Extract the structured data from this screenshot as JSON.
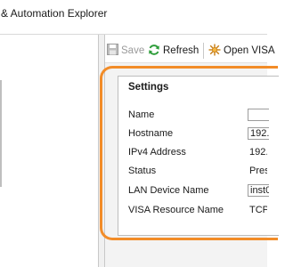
{
  "window": {
    "title": "& Automation Explorer"
  },
  "toolbar": {
    "save_label": "Save",
    "refresh_label": "Refresh",
    "open_visa_label": "Open VISA"
  },
  "settings": {
    "title": "Settings",
    "rows": [
      {
        "label": "Name",
        "value": ""
      },
      {
        "label": "Hostname",
        "value": "192."
      },
      {
        "label": "IPv4 Address",
        "value": "192."
      },
      {
        "label": "Status",
        "value": "Pres"
      },
      {
        "label": "LAN Device Name",
        "value": "inst0"
      },
      {
        "label": "VISA Resource Name",
        "value": "TCPI"
      }
    ]
  },
  "colors": {
    "highlight": "#f28c28",
    "refresh_icon": "#2e9d3a",
    "save_icon": "#9a9a9a"
  },
  "icons": {
    "save": "floppy-disk-icon",
    "refresh": "refresh-arrows-icon",
    "open_visa": "spark-burst-icon"
  }
}
